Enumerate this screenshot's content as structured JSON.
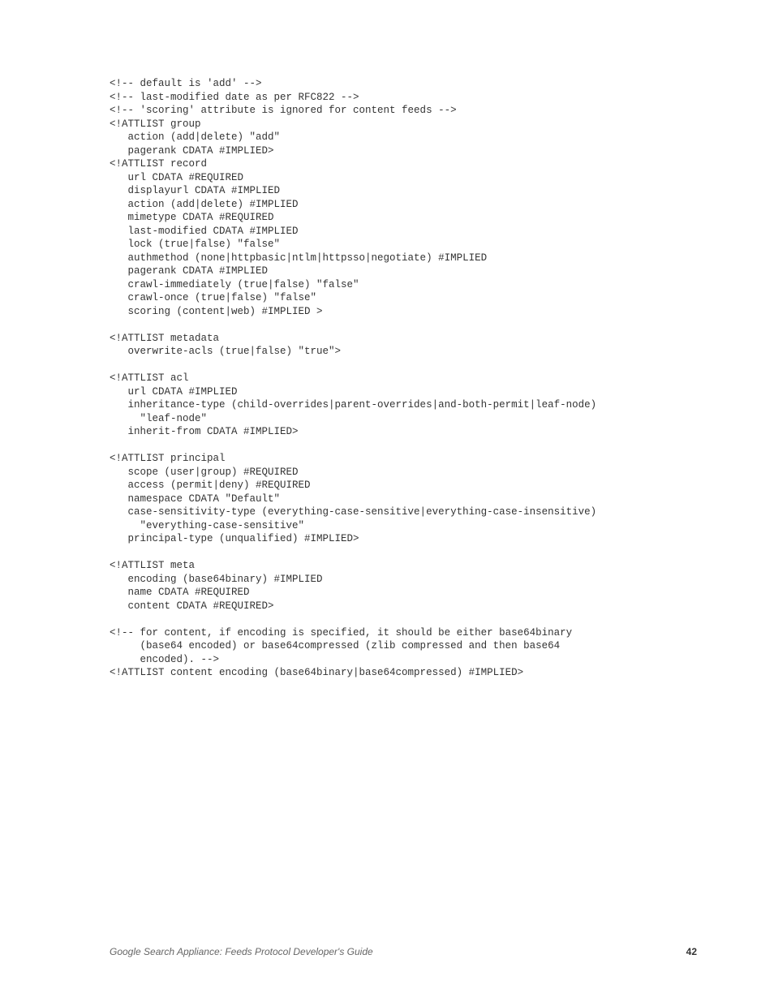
{
  "code": {
    "lines": [
      "<!-- default is 'add' -->",
      "<!-- last-modified date as per RFC822 -->",
      "<!-- 'scoring' attribute is ignored for content feeds -->",
      "<!ATTLIST group",
      "   action (add|delete) \"add\"",
      "   pagerank CDATA #IMPLIED>",
      "<!ATTLIST record",
      "   url CDATA #REQUIRED",
      "   displayurl CDATA #IMPLIED",
      "   action (add|delete) #IMPLIED",
      "   mimetype CDATA #REQUIRED",
      "   last-modified CDATA #IMPLIED",
      "   lock (true|false) \"false\"",
      "   authmethod (none|httpbasic|ntlm|httpsso|negotiate) #IMPLIED",
      "   pagerank CDATA #IMPLIED",
      "   crawl-immediately (true|false) \"false\"",
      "   crawl-once (true|false) \"false\"",
      "   scoring (content|web) #IMPLIED >",
      "",
      "<!ATTLIST metadata",
      "   overwrite-acls (true|false) \"true\">",
      "",
      "<!ATTLIST acl",
      "   url CDATA #IMPLIED",
      "   inheritance-type (child-overrides|parent-overrides|and-both-permit|leaf-node)",
      "     \"leaf-node\"",
      "   inherit-from CDATA #IMPLIED>",
      "",
      "<!ATTLIST principal",
      "   scope (user|group) #REQUIRED",
      "   access (permit|deny) #REQUIRED",
      "   namespace CDATA \"Default\"",
      "   case-sensitivity-type (everything-case-sensitive|everything-case-insensitive)",
      "     \"everything-case-sensitive\"",
      "   principal-type (unqualified) #IMPLIED>",
      "",
      "<!ATTLIST meta",
      "   encoding (base64binary) #IMPLIED",
      "   name CDATA #REQUIRED",
      "   content CDATA #REQUIRED>",
      "",
      "<!-- for content, if encoding is specified, it should be either base64binary",
      "     (base64 encoded) or base64compressed (zlib compressed and then base64",
      "     encoded). -->",
      "<!ATTLIST content encoding (base64binary|base64compressed) #IMPLIED>"
    ]
  },
  "footer": {
    "title": "Google Search Appliance: Feeds Protocol Developer's Guide",
    "page": "42"
  }
}
